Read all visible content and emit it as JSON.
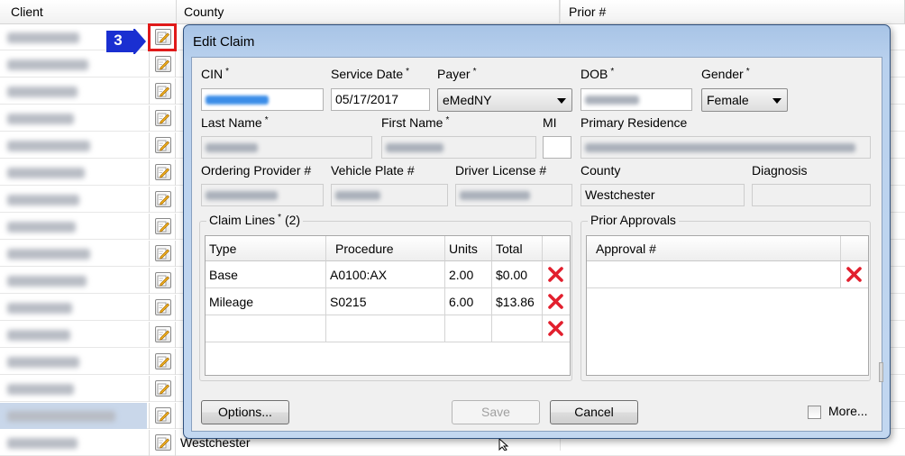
{
  "grid": {
    "columns": [
      "Client",
      "County",
      "Prior #"
    ],
    "rows": [
      {
        "client_redacted": true,
        "county": ""
      },
      {
        "client_redacted": true,
        "county": ""
      },
      {
        "client_redacted": true,
        "county": ""
      },
      {
        "client_redacted": true,
        "county": ""
      },
      {
        "client_redacted": true,
        "county": ""
      },
      {
        "client_redacted": true,
        "county": ""
      },
      {
        "client_redacted": true,
        "county": ""
      },
      {
        "client_redacted": true,
        "county": ""
      },
      {
        "client_redacted": true,
        "county": ""
      },
      {
        "client_redacted": true,
        "county": ""
      },
      {
        "client_redacted": true,
        "county": ""
      },
      {
        "client_redacted": true,
        "county": ""
      },
      {
        "client_redacted": true,
        "county": ""
      },
      {
        "client_redacted": true,
        "county": ""
      },
      {
        "client_redacted": true,
        "county": ""
      },
      {
        "client_redacted": true,
        "county": "Westchester"
      }
    ],
    "selected_row_index": 14,
    "highlighted_edit_row_index": 0
  },
  "callout": {
    "number": "3",
    "color": "#1a2fd1"
  },
  "dialog": {
    "title": "Edit Claim",
    "fields": {
      "cin": {
        "label": "CIN",
        "required": true
      },
      "service_date": {
        "label": "Service Date",
        "required": true,
        "value": "05/17/2017"
      },
      "payer": {
        "label": "Payer",
        "required": true,
        "value": "eMedNY"
      },
      "dob": {
        "label": "DOB",
        "required": true
      },
      "gender": {
        "label": "Gender",
        "required": true,
        "value": "Female"
      },
      "last_name": {
        "label": "Last Name",
        "required": true
      },
      "first_name": {
        "label": "First Name",
        "required": true
      },
      "mi": {
        "label": "MI"
      },
      "primary_residence": {
        "label": "Primary Residence"
      },
      "ordering_provider": {
        "label": "Ordering Provider #"
      },
      "vehicle_plate": {
        "label": "Vehicle Plate #"
      },
      "driver_license": {
        "label": "Driver License #"
      },
      "county": {
        "label": "County",
        "value": "Westchester"
      },
      "diagnosis": {
        "label": "Diagnosis",
        "value": ""
      }
    },
    "claim_lines": {
      "title": "Claim Lines",
      "required": true,
      "count_text": "(2)",
      "columns": [
        "Type",
        "Procedure",
        "Units",
        "Total"
      ],
      "rows": [
        {
          "type": "Base",
          "procedure": "A0100:AX",
          "units": "2.00",
          "total": "$0.00"
        },
        {
          "type": "Mileage",
          "procedure": "S0215",
          "units": "6.00",
          "total": "$13.86"
        },
        {
          "type": "",
          "procedure": "",
          "units": "",
          "total": ""
        }
      ]
    },
    "prior_approvals": {
      "title": "Prior Approvals",
      "columns": [
        "Approval #"
      ],
      "rows": [
        {
          "approval": ""
        }
      ]
    },
    "buttons": {
      "options": "Options...",
      "save": "Save",
      "cancel": "Cancel",
      "more": "More..."
    },
    "more_checked": false
  },
  "colors": {
    "delete_icon": "#e2202e",
    "highlight_box": "#e01a1a",
    "selection": "#c9d7ea",
    "dialog_frame": "#b9d1ee"
  }
}
